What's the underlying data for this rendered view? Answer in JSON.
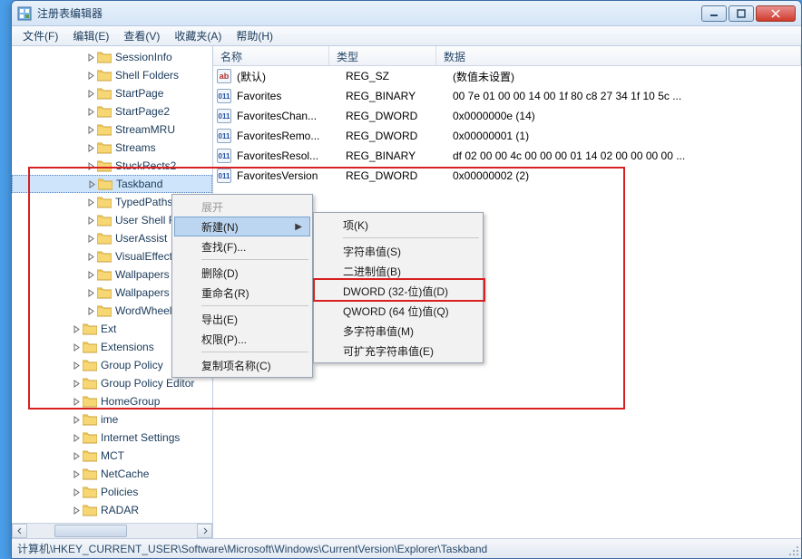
{
  "window": {
    "title": "注册表编辑器"
  },
  "menubar": [
    "文件(F)",
    "编辑(E)",
    "查看(V)",
    "收藏夹(A)",
    "帮助(H)"
  ],
  "tree": {
    "items": [
      {
        "indent": 5,
        "label": "SessionInfo",
        "exp": true
      },
      {
        "indent": 5,
        "label": "Shell Folders",
        "exp": false
      },
      {
        "indent": 5,
        "label": "StartPage",
        "exp": false
      },
      {
        "indent": 5,
        "label": "StartPage2",
        "exp": false
      },
      {
        "indent": 5,
        "label": "StreamMRU",
        "exp": false
      },
      {
        "indent": 5,
        "label": "Streams",
        "exp": true
      },
      {
        "indent": 5,
        "label": "StuckRects2",
        "exp": false
      },
      {
        "indent": 5,
        "label": "Taskband",
        "exp": false,
        "selected": true
      },
      {
        "indent": 5,
        "label": "TypedPaths",
        "exp": false
      },
      {
        "indent": 5,
        "label": "User Shell Folders",
        "exp": false
      },
      {
        "indent": 5,
        "label": "UserAssist",
        "exp": true
      },
      {
        "indent": 5,
        "label": "VisualEffects",
        "exp": true
      },
      {
        "indent": 5,
        "label": "Wallpapers",
        "exp": true
      },
      {
        "indent": 5,
        "label": "Wallpapers",
        "exp": true
      },
      {
        "indent": 5,
        "label": "WordWheelQuery",
        "exp": false
      },
      {
        "indent": 4,
        "label": "Ext",
        "exp": true
      },
      {
        "indent": 4,
        "label": "Extensions",
        "exp": false
      },
      {
        "indent": 4,
        "label": "Group Policy",
        "exp": true
      },
      {
        "indent": 4,
        "label": "Group Policy Editor",
        "exp": false
      },
      {
        "indent": 4,
        "label": "HomeGroup",
        "exp": false
      },
      {
        "indent": 4,
        "label": "ime",
        "exp": true
      },
      {
        "indent": 4,
        "label": "Internet Settings",
        "exp": true
      },
      {
        "indent": 4,
        "label": "MCT",
        "exp": true
      },
      {
        "indent": 4,
        "label": "NetCache",
        "exp": false
      },
      {
        "indent": 4,
        "label": "Policies",
        "exp": true
      },
      {
        "indent": 4,
        "label": "RADAR",
        "exp": true
      }
    ]
  },
  "list": {
    "headers": {
      "name": "名称",
      "type": "类型",
      "data": "数据"
    },
    "rows": [
      {
        "icon": "str",
        "name": "(默认)",
        "type": "REG_SZ",
        "data": "(数值未设置)"
      },
      {
        "icon": "bin",
        "name": "Favorites",
        "type": "REG_BINARY",
        "data": "00 7e 01 00 00 14 00 1f 80 c8 27 34 1f 10 5c ..."
      },
      {
        "icon": "bin",
        "name": "FavoritesChan...",
        "type": "REG_DWORD",
        "data": "0x0000000e (14)"
      },
      {
        "icon": "bin",
        "name": "FavoritesRemo...",
        "type": "REG_DWORD",
        "data": "0x00000001 (1)"
      },
      {
        "icon": "bin",
        "name": "FavoritesResol...",
        "type": "REG_BINARY",
        "data": "df 02 00 00 4c 00 00 00 01 14 02 00 00 00 00 ..."
      },
      {
        "icon": "bin",
        "name": "FavoritesVersion",
        "type": "REG_DWORD",
        "data": "0x00000002 (2)"
      }
    ]
  },
  "context1": {
    "items": [
      {
        "label": "展开",
        "disabled": true
      },
      {
        "label": "新建(N)",
        "submenu": true,
        "hover": true
      },
      {
        "label": "查找(F)..."
      },
      {
        "sep": true
      },
      {
        "label": "删除(D)"
      },
      {
        "label": "重命名(R)"
      },
      {
        "sep": true
      },
      {
        "label": "导出(E)"
      },
      {
        "label": "权限(P)..."
      },
      {
        "sep": true
      },
      {
        "label": "复制项名称(C)"
      }
    ]
  },
  "context2": {
    "items": [
      {
        "label": "项(K)"
      },
      {
        "sep": true
      },
      {
        "label": "字符串值(S)"
      },
      {
        "label": "二进制值(B)"
      },
      {
        "label": "DWORD (32-位)值(D)"
      },
      {
        "label": "QWORD (64 位)值(Q)"
      },
      {
        "label": "多字符串值(M)"
      },
      {
        "label": "可扩充字符串值(E)"
      }
    ]
  },
  "statusbar": "计算机\\HKEY_CURRENT_USER\\Software\\Microsoft\\Windows\\CurrentVersion\\Explorer\\Taskband"
}
